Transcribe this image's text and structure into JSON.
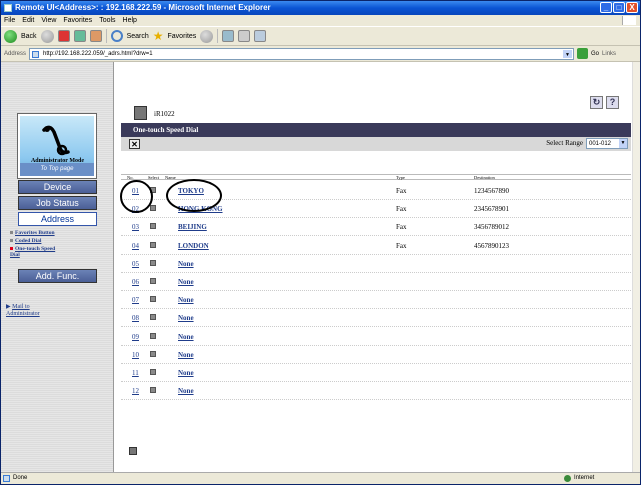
{
  "window": {
    "title": "Remote UI<Address>: : 192.168.222.59 - Microsoft Internet Explorer",
    "controls": [
      "_",
      "□",
      "X"
    ]
  },
  "menu": [
    "File",
    "Edit",
    "View",
    "Favorites",
    "Tools",
    "Help"
  ],
  "toolbar": {
    "back_label": "Back",
    "search_label": "Search",
    "favorites_label": "Favorites"
  },
  "address_bar": {
    "label": "Address",
    "url": "http://192.168.222.059/_adrs.html?drw=1",
    "go_label": "Go",
    "links_label": "Links"
  },
  "nav": {
    "top_caption": "To Top page",
    "mode": "Administrator Mode",
    "buttons": [
      "Device",
      "Job Status",
      "Address",
      "Add. Func."
    ],
    "active_button": "Address",
    "sub_items": [
      "Favorites Button",
      "Coded Dial",
      "One-touch Speed Dial"
    ],
    "current_sub_item": "One-touch Speed Dial",
    "mail_link": [
      "Mail to",
      "Administrator"
    ]
  },
  "device": {
    "name": "iR1022"
  },
  "section": {
    "title": "One-touch Speed Dial",
    "range_label": "Select Range",
    "range_value": "001-012"
  },
  "table": {
    "headers": {
      "no": "No.",
      "select": "Select",
      "name": "Name",
      "type": "Type",
      "destination": "Destination"
    },
    "rows": [
      {
        "no": "01",
        "name": "TOKYO",
        "type": "Fax",
        "destination": "1234567890"
      },
      {
        "no": "02",
        "name": "HONG KONG",
        "type": "Fax",
        "destination": "2345678901"
      },
      {
        "no": "03",
        "name": "BEIJING",
        "type": "Fax",
        "destination": "3456789012"
      },
      {
        "no": "04",
        "name": "LONDON",
        "type": "Fax",
        "destination": "4567890123"
      },
      {
        "no": "05",
        "name": "None",
        "type": "",
        "destination": ""
      },
      {
        "no": "06",
        "name": "None",
        "type": "",
        "destination": ""
      },
      {
        "no": "07",
        "name": "None",
        "type": "",
        "destination": ""
      },
      {
        "no": "08",
        "name": "None",
        "type": "",
        "destination": ""
      },
      {
        "no": "09",
        "name": "None",
        "type": "",
        "destination": ""
      },
      {
        "no": "10",
        "name": "None",
        "type": "",
        "destination": ""
      },
      {
        "no": "11",
        "name": "None",
        "type": "",
        "destination": ""
      },
      {
        "no": "12",
        "name": "None",
        "type": "",
        "destination": ""
      }
    ]
  },
  "status_bar": {
    "text": "Done",
    "zone": "Internet"
  }
}
